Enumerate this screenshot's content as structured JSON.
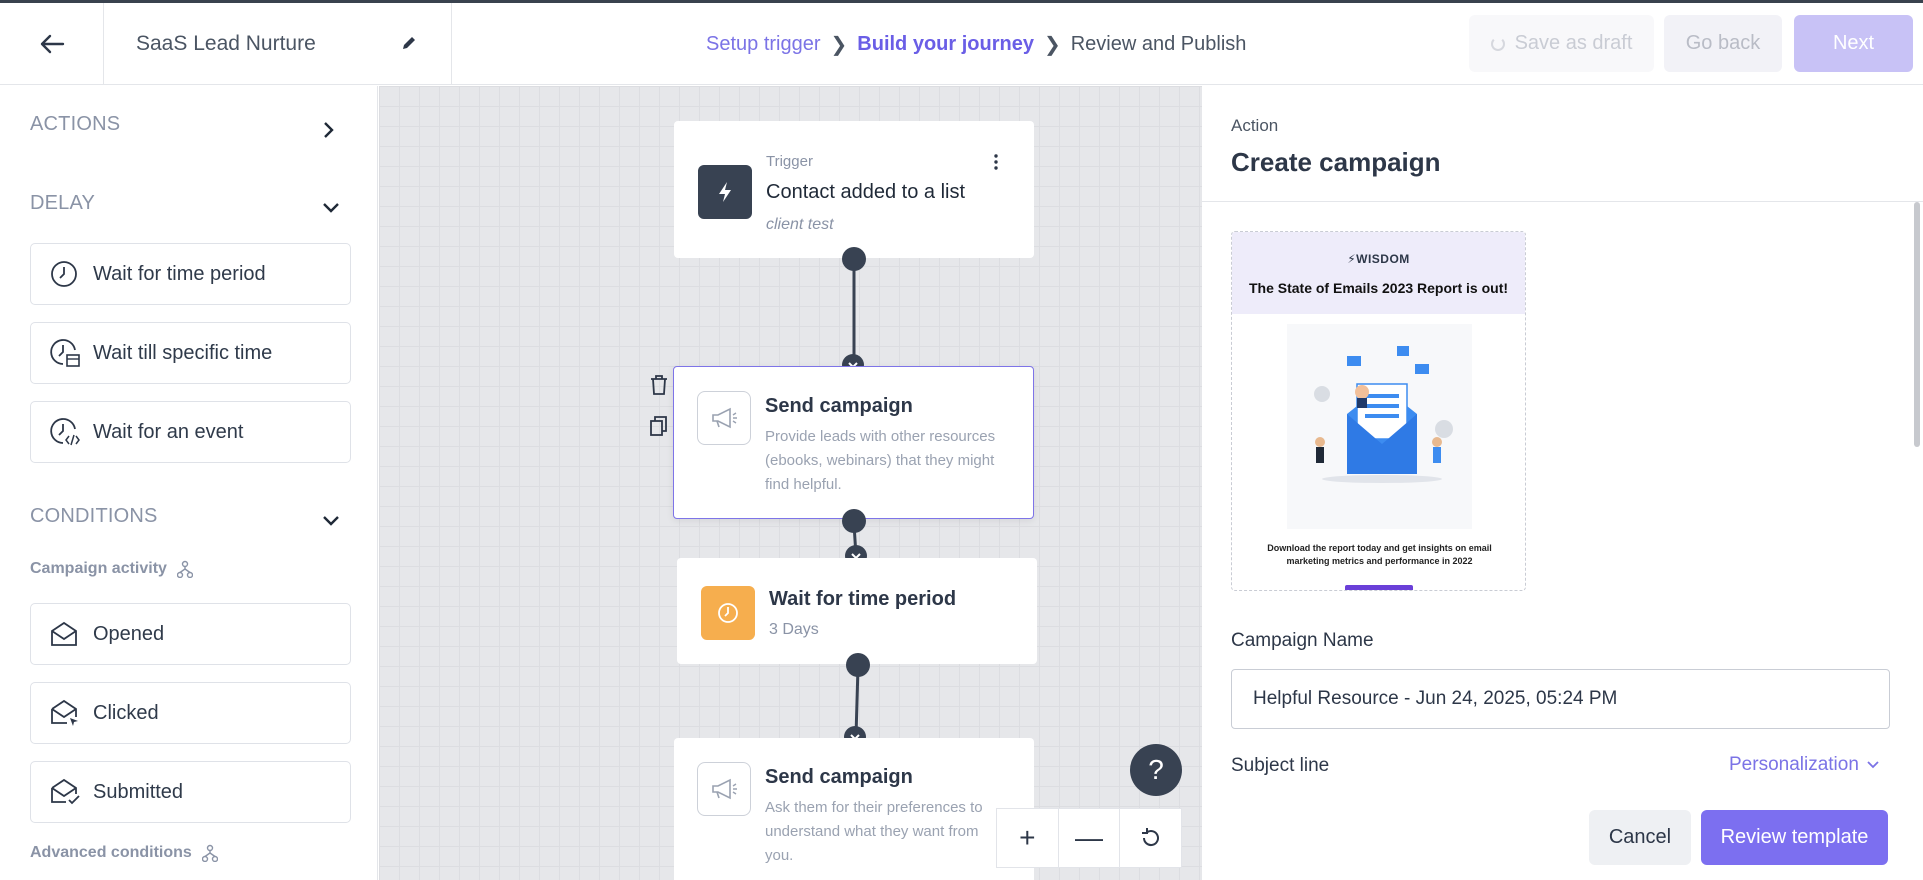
{
  "header": {
    "journey_title": "SaaS Lead Nurture",
    "steps": [
      {
        "label": "Setup trigger",
        "state": "done"
      },
      {
        "label": "Build your journey",
        "state": "active"
      },
      {
        "label": "Review and Publish",
        "state": "pending"
      }
    ],
    "save_draft_label": "Save as draft",
    "go_back_label": "Go back",
    "next_label": "Next"
  },
  "sidebar": {
    "actions_label": "ACTIONS",
    "delay_label": "DELAY",
    "delay_items": [
      "Wait for time period",
      "Wait till specific time",
      "Wait for an event"
    ],
    "conditions_label": "CONDITIONS",
    "campaign_activity_label": "Campaign activity",
    "campaign_items": [
      "Opened",
      "Clicked",
      "Submitted"
    ],
    "advanced_label": "Advanced conditions"
  },
  "canvas": {
    "nodes": [
      {
        "kind": "Trigger",
        "title": "Contact added to a list",
        "subtitle": "client test"
      },
      {
        "title": "Send campaign",
        "desc": "Provide leads with other resources (ebooks, webinars) that they might find helpful."
      },
      {
        "title": "Wait for time period",
        "subtitle": "3 Days"
      },
      {
        "title": "Send campaign",
        "desc": "Ask them for their preferences to understand what they want from you."
      }
    ],
    "help_label": "?",
    "zoom_in": "+",
    "zoom_out": "—"
  },
  "panel": {
    "kind": "Action",
    "title": "Create campaign",
    "preview": {
      "brand": "WISDOM",
      "headline": "The State of Emails 2023 Report is out!",
      "footer": "Download the report today and get insights on email marketing metrics and performance in 2022"
    },
    "campaign_name_label": "Campaign Name",
    "campaign_name_value": "Helpful Resource - Jun 24, 2025, 05:24 PM",
    "subject_label": "Subject line",
    "personalization_label": "Personalization",
    "cancel_label": "Cancel",
    "review_label": "Review template"
  },
  "colors": {
    "accent": "#7c6ff0",
    "dark_node": "#384252",
    "wait_orange": "#f6ae4e",
    "canvas_bg": "#e6e7ea"
  }
}
